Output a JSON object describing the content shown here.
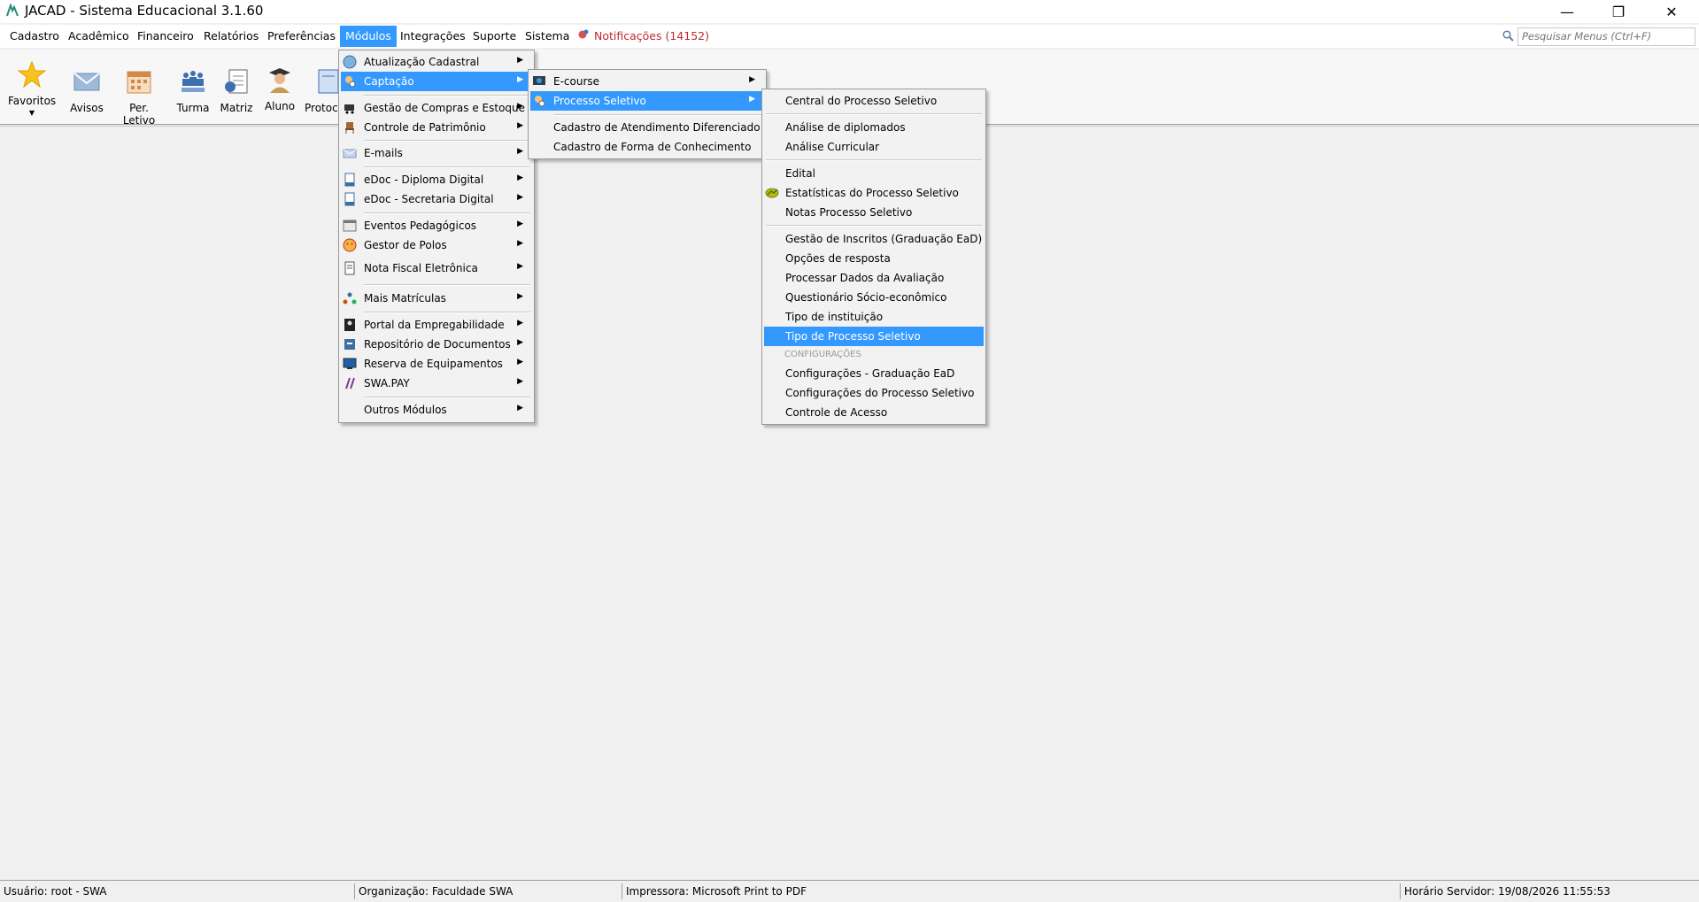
{
  "window": {
    "title": "JACAD - Sistema Educacional 3.1.60"
  },
  "menubar": {
    "cadastro": "Cadastro",
    "academico": "Acadêmico",
    "financeiro": "Financeiro",
    "relatorios": "Relatórios",
    "preferencias": "Preferências",
    "modulos": "Módulos",
    "integracoes": "Integrações",
    "suporte": "Suporte",
    "sistema": "Sistema",
    "notificacoes": "Notificações (14152)"
  },
  "search": {
    "placeholder": "Pesquisar Menus (Ctrl+F)"
  },
  "toolbar": {
    "favoritos": "Favoritos",
    "avisos": "Avisos",
    "per_letivo": "Per. Letivo",
    "turma": "Turma",
    "matriz": "Matriz",
    "aluno": "Aluno",
    "protocolo": "Protoc"
  },
  "modulos_menu": {
    "atualizacao": "Atualização Cadastral",
    "captacao": "Captação",
    "compras": "Gestão de Compras e Estoque",
    "patrimonio": "Controle de Patrimônio",
    "emails": "E-mails",
    "edoc_diploma": "eDoc - Diploma Digital",
    "edoc_secretaria": "eDoc - Secretaria Digital",
    "eventos": "Eventos Pedagógicos",
    "polos": "Gestor de Polos",
    "nota_fiscal": "Nota Fiscal Eletrônica",
    "mais_matriculas": "Mais Matrículas",
    "empregabilidade": "Portal da Empregabilidade",
    "repositorio": "Repositório de Documentos",
    "reserva": "Reserva de Equipamentos",
    "swa_pay": "SWA.PAY",
    "outros": "Outros Módulos"
  },
  "captacao_menu": {
    "ecourse": "E-course",
    "processo_seletivo": "Processo Seletivo",
    "atendimento": "Cadastro de Atendimento Diferenciado",
    "forma_conhecimento": "Cadastro de Forma de Conhecimento"
  },
  "processo_menu": {
    "central": "Central do Processo Seletivo",
    "analise_diplomados": "Análise de diplomados",
    "analise_curricular": "Análise Curricular",
    "edital": "Edital",
    "estatisticas": "Estatísticas do Processo Seletivo",
    "notas": "Notas Processo Seletivo",
    "gestao_inscritos": "Gestão de Inscritos (Graduação EaD)",
    "opcoes_resposta": "Opções de resposta",
    "processar_dados": "Processar Dados da Avaliação",
    "questionario": "Questionário Sócio-econômico",
    "tipo_instituicao": "Tipo de instituição",
    "tipo_processo": "Tipo de Processo Seletivo",
    "configuracoes_header": "CONFIGURAÇÕES",
    "config_ead": "Configurações - Graduação EaD",
    "config_processo": "Configurações do Processo Seletivo",
    "controle_acesso": "Controle de Acesso"
  },
  "statusbar": {
    "usuario": "Usuário: root - SWA",
    "organizacao": "Organização: Faculdade SWA",
    "impressora": "Impressora: Microsoft Print to PDF",
    "horario": "Horário Servidor: 19/08/2026 11:55:53"
  },
  "colors": {
    "highlight": "#3399ff",
    "notification": "#c0282d"
  }
}
